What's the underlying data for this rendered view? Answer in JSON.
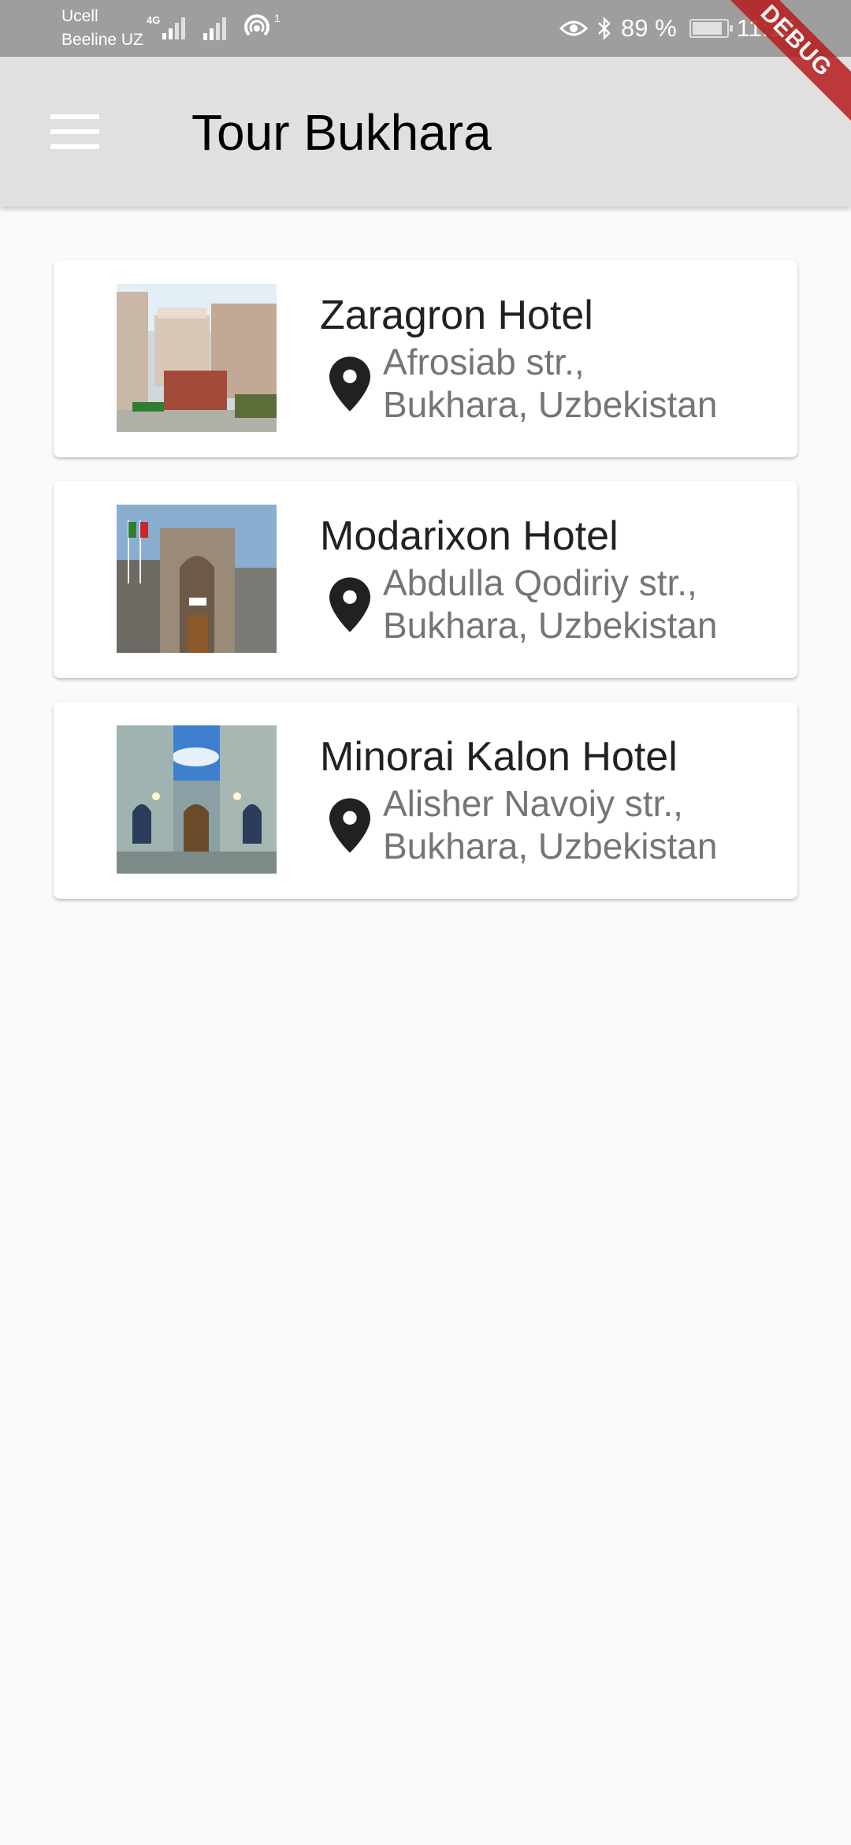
{
  "status_bar": {
    "carrier_1": "Ucell",
    "carrier_2": "Beeline UZ",
    "network_type": "4G",
    "hotspot_count": "1",
    "battery": "89 %",
    "battery_level": 0.89,
    "time": "11:15"
  },
  "debug_banner": "DEBUG",
  "app_bar": {
    "title": "Tour Bukhara",
    "menu_icon": "menu-icon"
  },
  "hotels": [
    {
      "name": "Zaragron Hotel",
      "address_line1": "Afrosiab str.,",
      "address_line2": "Bukhara, Uzbekistan"
    },
    {
      "name": "Modarixon Hotel",
      "address_line1": "Abdulla Qodiriy str.,",
      "address_line2": "Bukhara, Uzbekistan"
    },
    {
      "name": "Minorai Kalon Hotel",
      "address_line1": "Alisher Navoiy str.,",
      "address_line2": "Bukhara, Uzbekistan"
    }
  ],
  "colors": {
    "status_bar": "#9e9e9e",
    "app_bar": "#e0e0e0",
    "background": "#fafafa",
    "debug_banner": "#b71c1c",
    "address_text": "#757575"
  }
}
